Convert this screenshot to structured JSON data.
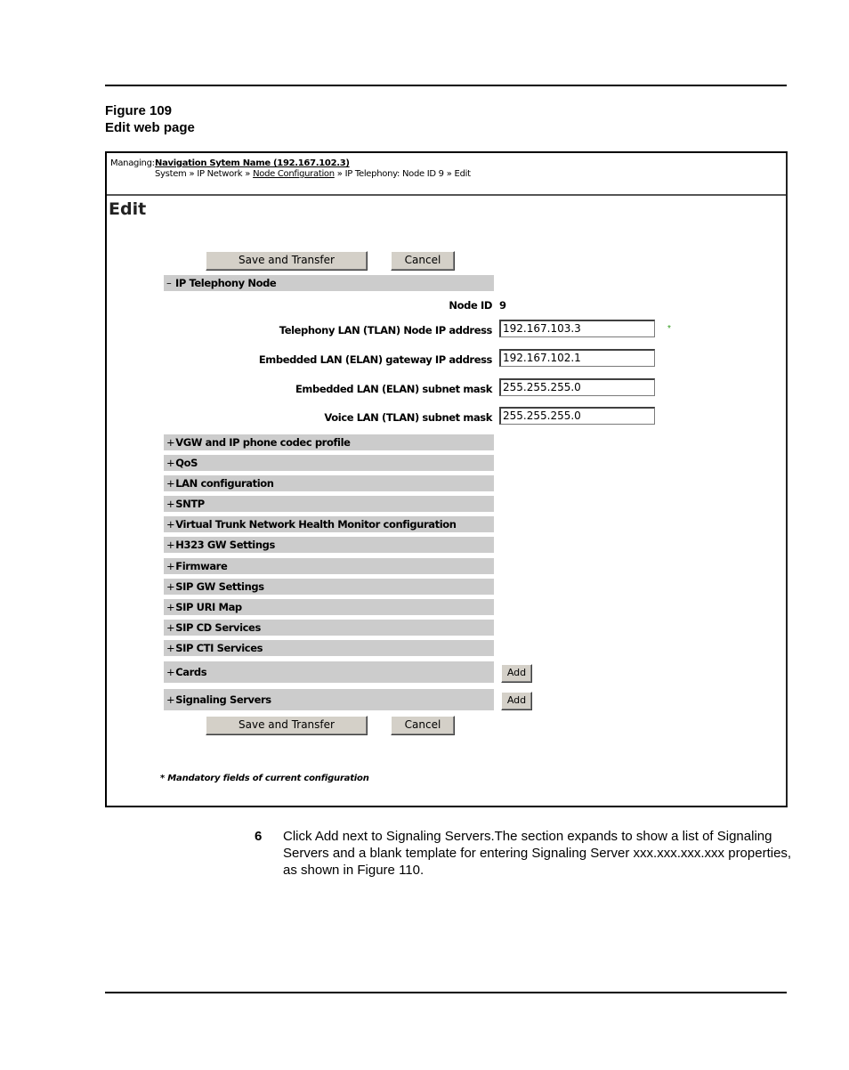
{
  "figure": {
    "number_label": "Figure 109",
    "caption": "Edit web page"
  },
  "header": {
    "managing_label": "Managing:",
    "system_name": "Navigation Sytem Name (192.167.102.3)",
    "breadcrumb": [
      {
        "label": "System",
        "link": false
      },
      {
        "label": "IP Network",
        "link": false
      },
      {
        "label": "Node Configuration",
        "link": true
      },
      {
        "label": "IP Telephony: Node ID 9",
        "link": false
      },
      {
        "label": "Edit",
        "link": false
      }
    ],
    "separator": "»"
  },
  "page_title": "Edit",
  "buttons": {
    "save_transfer": "Save and Transfer",
    "cancel": "Cancel",
    "add": "Add"
  },
  "ip_telephony_node": {
    "toggle": "–",
    "title": "IP Telephony Node",
    "node_id_label": "Node ID",
    "node_id_value": "9",
    "fields": [
      {
        "label": "Telephony LAN (TLAN) Node IP address",
        "value": "192.167.103.3",
        "mandatory": true
      },
      {
        "label": "Embedded LAN (ELAN) gateway IP address",
        "value": "192.167.102.1",
        "mandatory": false
      },
      {
        "label": "Embedded LAN (ELAN) subnet mask",
        "value": "255.255.255.0",
        "mandatory": false
      },
      {
        "label": "Voice LAN (TLAN) subnet mask",
        "value": "255.255.255.0",
        "mandatory": false
      }
    ],
    "mandatory_mark": "*"
  },
  "sections": [
    {
      "toggle": "+",
      "title": "VGW and IP phone codec profile"
    },
    {
      "toggle": "+",
      "title": "QoS"
    },
    {
      "toggle": "+",
      "title": "LAN configuration"
    },
    {
      "toggle": "+",
      "title": "SNTP"
    },
    {
      "toggle": "+",
      "title": "Virtual Trunk Network Health Monitor configuration"
    },
    {
      "toggle": "+",
      "title": "H323 GW Settings"
    },
    {
      "toggle": "+",
      "title": "Firmware"
    },
    {
      "toggle": "+",
      "title": "SIP GW Settings"
    },
    {
      "toggle": "+",
      "title": "SIP URI Map"
    },
    {
      "toggle": "+",
      "title": "SIP CD Services"
    },
    {
      "toggle": "+",
      "title": "SIP CTI Services"
    },
    {
      "toggle": "+",
      "title": "Cards"
    },
    {
      "toggle": "+",
      "title": "Signaling Servers"
    }
  ],
  "footnote": "* Mandatory fields of current configuration",
  "step": {
    "number": "6",
    "text": "Click Add next to Signaling Servers.The section expands to show a list of Signaling Servers and a blank template for entering Signaling Server xxx.xxx.xxx.xxx properties, as shown in Figure 110."
  },
  "colors": {
    "section_bg": "#cccccc",
    "button_bg": "#d4d0c8",
    "mandatory": "#2f9a1a"
  }
}
